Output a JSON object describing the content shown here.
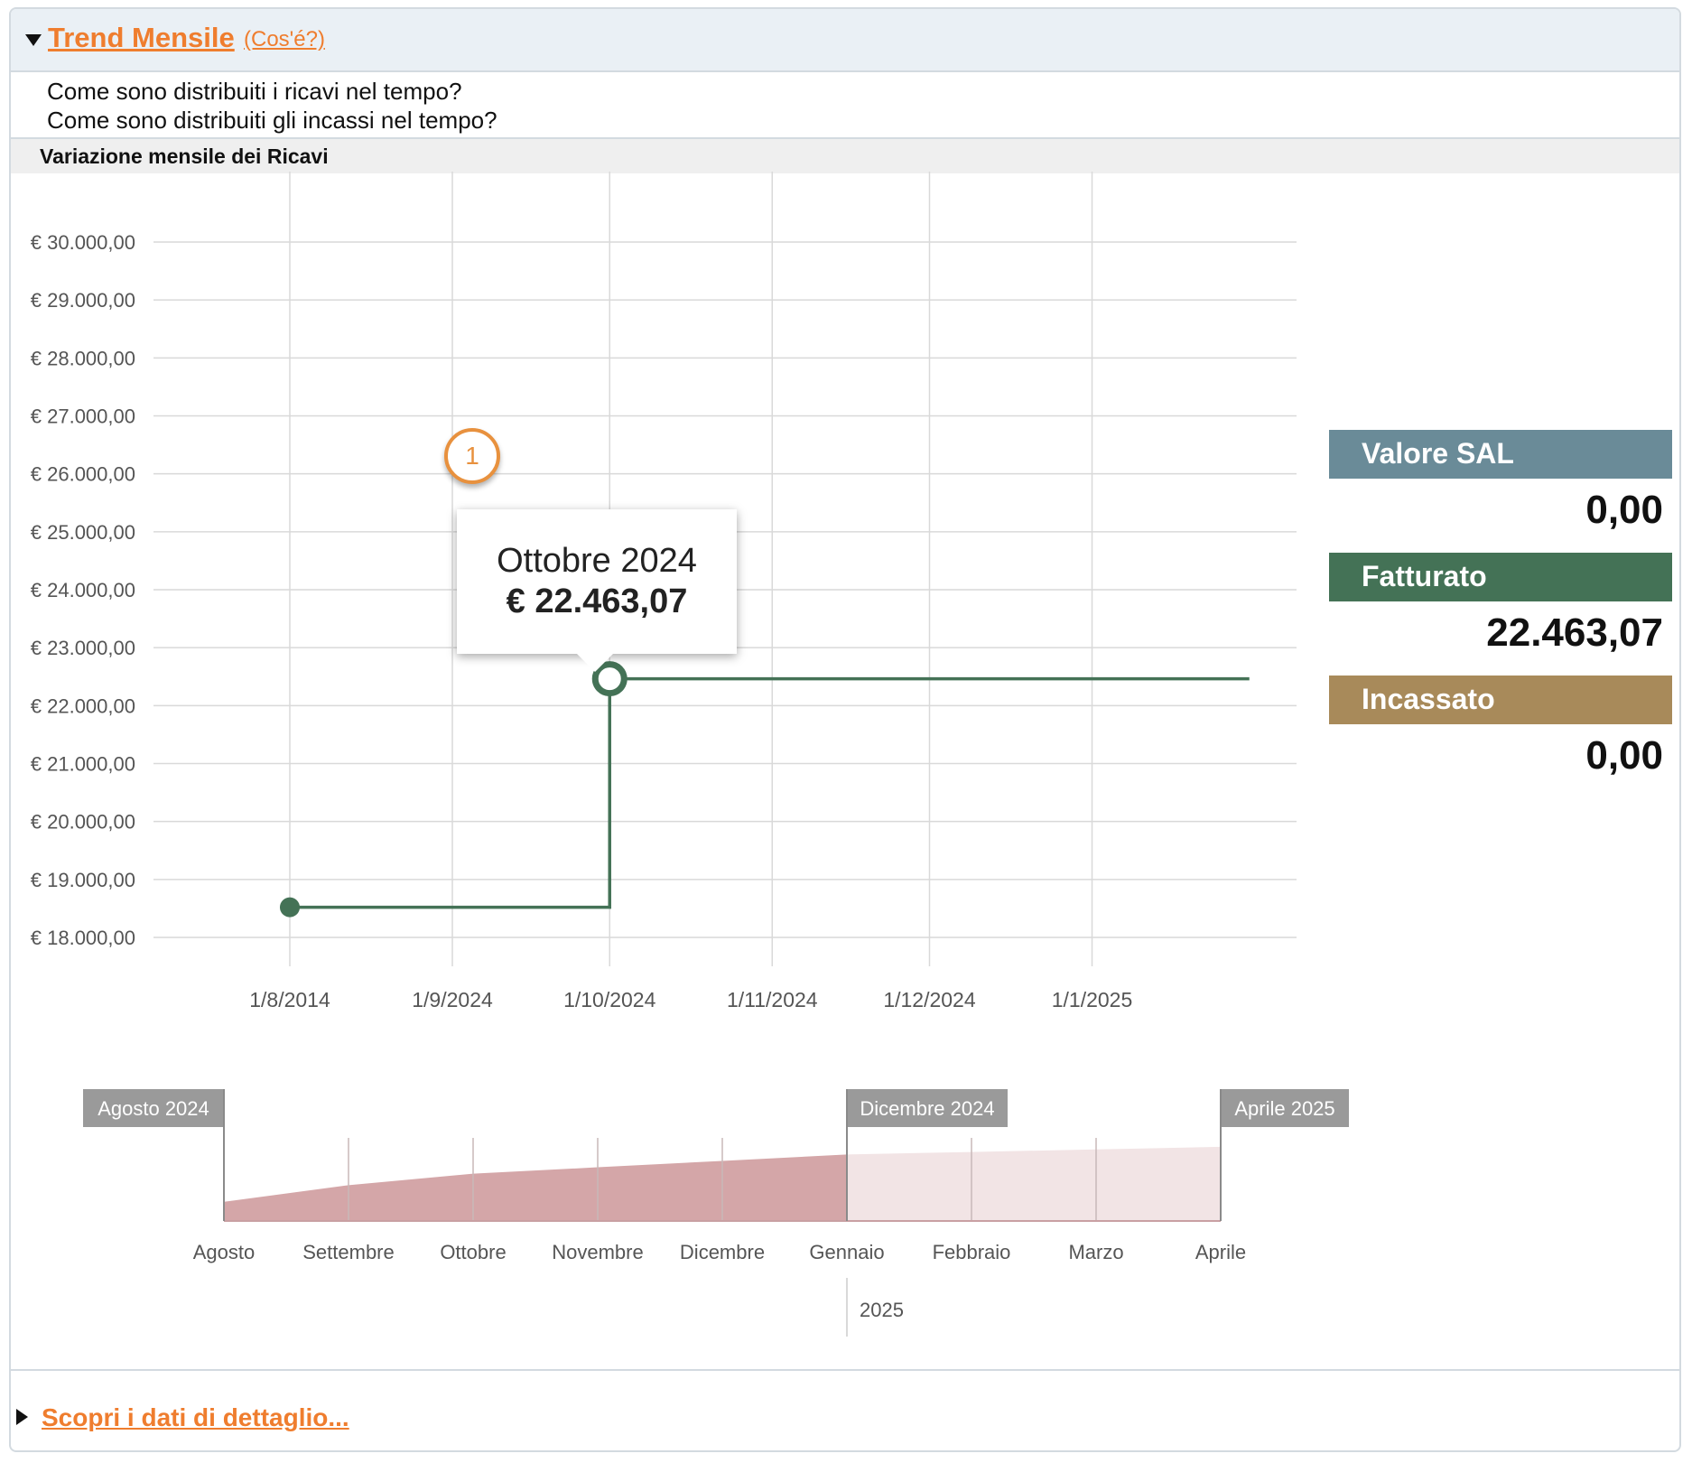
{
  "header": {
    "title": "Trend Mensile",
    "help_link": "(Cos'é?)"
  },
  "questions": [
    "Come sono distribuiti i ricavi nel tempo?",
    "Come sono distribuiti gli incassi nel tempo?"
  ],
  "section": {
    "title": "Variazione mensile dei Ricavi"
  },
  "tooltip": {
    "month": "Ottobre 2024",
    "value": "€ 22.463,07"
  },
  "marker_label": "1",
  "legend": {
    "items": [
      {
        "label": "Valore SAL",
        "value": "0,00",
        "color": "#6a8b98"
      },
      {
        "label": "Fatturato",
        "value": "22.463,07",
        "color": "#447256"
      },
      {
        "label": "Incassato",
        "value": "0,00",
        "color": "#a88a5a"
      }
    ]
  },
  "footer": {
    "detail_link": "Scopri i dati di dettaglio..."
  },
  "chart_data": [
    {
      "type": "line",
      "step": true,
      "y_tick_labels": [
        "€ 30.000,00",
        "€ 29.000,00",
        "€ 28.000,00",
        "€ 27.000,00",
        "€ 26.000,00",
        "€ 25.000,00",
        "€ 24.000,00",
        "€ 23.000,00",
        "€ 22.000,00",
        "€ 21.000,00",
        "€ 20.000,00",
        "€ 19.000,00",
        "€ 18.000,00"
      ],
      "ylim": [
        18000,
        30000
      ],
      "x_tick_labels": [
        "1/8/2014",
        "1/9/2024",
        "1/10/2024",
        "1/11/2024",
        "1/12/2024",
        "1/1/2025"
      ],
      "series": [
        {
          "color": "#447256",
          "points": [
            {
              "x": "2024-08-01",
              "y": 18520
            },
            {
              "x": "2024-10-01",
              "y": 22463.07
            },
            {
              "x": "2025-01-31",
              "y": 22463.07
            }
          ]
        }
      ],
      "grid": true
    },
    {
      "type": "area",
      "role": "range-navigator",
      "month_labels": [
        "Agosto",
        "Settembre",
        "Ottobre",
        "Novembre",
        "Dicembre",
        "Gennaio",
        "Febbraio",
        "Marzo",
        "Aprile"
      ],
      "year_label": "2025",
      "range_flags": [
        "Agosto 2024",
        "Dicembre 2024",
        "Aprile 2025"
      ],
      "selected_range": [
        "Agosto 2024",
        "Dicembre 2024"
      ],
      "values": [
        18500,
        19800,
        20700,
        21200,
        21700,
        22200,
        22400,
        22600,
        22800
      ],
      "selected_color": "#d4a6a8",
      "unselected_color": "#f2e4e5"
    }
  ]
}
